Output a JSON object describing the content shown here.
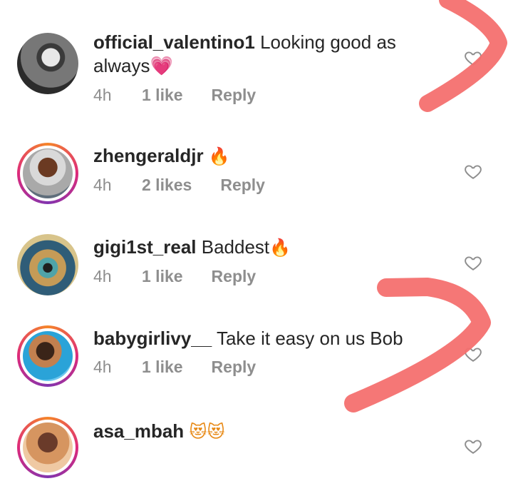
{
  "comments": [
    {
      "username": "official_valentino1",
      "text": "Looking good as",
      "text_line2": "always",
      "emoji": "💗",
      "emoji_name": "pink-heart",
      "time": "4h",
      "likes": "1 like",
      "reply": "Reply",
      "story_ring": false
    },
    {
      "username": "zhengeraldjr",
      "text": "",
      "emoji": "🔥",
      "emoji_name": "fire",
      "time": "4h",
      "likes": "2 likes",
      "reply": "Reply",
      "story_ring": true
    },
    {
      "username": "gigi1st_real",
      "text": "Baddest",
      "emoji": "🔥",
      "emoji_name": "fire",
      "time": "4h",
      "likes": "1 like",
      "reply": "Reply",
      "story_ring": false
    },
    {
      "username": "babygirlivy__",
      "text": "Take it easy on us Bob",
      "emoji": "",
      "time": "4h",
      "likes": "1 like",
      "reply": "Reply",
      "story_ring": true
    },
    {
      "username": "asa_mbah",
      "text": "",
      "emoji": "😻😻",
      "emoji_name": "heart-eyes-cat",
      "story_ring": true
    }
  ],
  "colors": {
    "username": "#262626",
    "meta": "#8e8e8e",
    "scribble": "#f4706f",
    "like_icon": "#8e8e8e"
  },
  "icons": {
    "like": "heart-outline-icon"
  }
}
